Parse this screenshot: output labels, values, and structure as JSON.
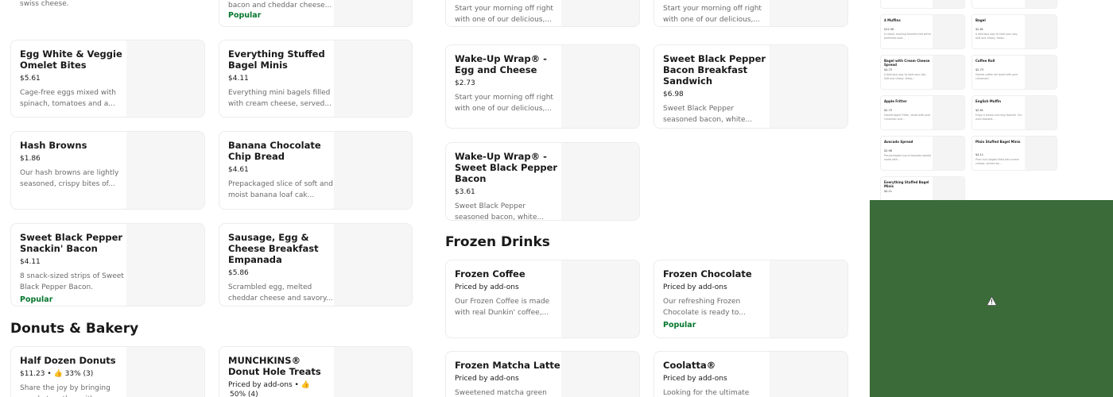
{
  "top_fragments": {
    "col1": "swiss cheese.",
    "col2_desc": "bacon and cheddar cheese...",
    "col2_badge": "Popular",
    "col3_l1": "Start your morning off right",
    "col3_l2": "with one of our delicious,...",
    "col4_l1": "Start your morning off right",
    "col4_l2": "with one of our delicious,..."
  },
  "col1": [
    {
      "title": "Egg White & Veggie Omelet Bites",
      "price": "$5.61",
      "desc": "Cage-free eggs mixed with spinach, tomatoes and a...",
      "popular": ""
    },
    {
      "title": "Hash Browns",
      "price": "$1.86",
      "desc": "Our hash browns are lightly seasoned, crispy bites of...",
      "popular": ""
    },
    {
      "title": "Sweet Black Pepper Snackin' Bacon",
      "price": "$4.11",
      "desc": "8 snack-sized strips of Sweet Black Pepper Bacon.",
      "popular": "Popular"
    }
  ],
  "col2": [
    {
      "title": "Everything Stuffed Bagel Minis",
      "price": "$4.11",
      "desc": "Everything mini bagels filled with cream cheese, served...",
      "popular": ""
    },
    {
      "title": "Banana Chocolate Chip Bread",
      "price": "$4.61",
      "desc": "Prepackaged slice of soft and moist banana loaf cak...",
      "popular": ""
    },
    {
      "title": "Sausage, Egg & Cheese Breakfast Empanada",
      "price": "$5.86",
      "desc": "Scrambled egg, melted cheddar cheese and savory...",
      "popular": ""
    }
  ],
  "col3": [
    {
      "title": "Wake-Up Wrap® - Egg and Cheese",
      "price": "$2.73",
      "desc": "Start your morning off right with one of our delicious,...",
      "popular": ""
    },
    {
      "title": "Wake-Up Wrap® - Sweet Black Pepper Bacon",
      "price": "$3.61",
      "desc": "Sweet Black Pepper seasoned bacon, white...",
      "popular": ""
    }
  ],
  "col4": [
    {
      "title": "Sweet Black Pepper Bacon Breakfast Sandwich",
      "price": "$6.98",
      "desc": "Sweet Black Pepper seasoned bacon, white...",
      "popular": ""
    }
  ],
  "sections": {
    "donuts": "Donuts & Bakery",
    "frozen": "Frozen Drinks"
  },
  "donuts": [
    {
      "title": "Half Dozen Donuts",
      "price": "$11.23 •",
      "rating": "33% (3)",
      "desc": "Share the joy by bringing people together with an..."
    },
    {
      "title": "MUNCHKINS® Donut Hole Treats",
      "price": "Priced by add-ons •",
      "rating": "50% (4)",
      "desc": ""
    }
  ],
  "frozen": [
    {
      "title": "Frozen Coffee",
      "price": "Priced by add-ons",
      "desc": "Our Frozen Coffee is made with real Dunkin' coffee,...",
      "popular": ""
    },
    {
      "title": "Frozen Chocolate",
      "price": "Priced by add-ons",
      "desc": "Our refreshing Frozen Chocolate is ready to...",
      "popular": "Popular"
    },
    {
      "title": "Frozen Matcha Latte",
      "price": "Priced by add-ons",
      "desc": "Sweetened matcha green",
      "popular": ""
    },
    {
      "title": "Coolatta®",
      "price": "Priced by add-ons",
      "desc": "Looking for the ultimate",
      "popular": ""
    }
  ],
  "thumbnail": {
    "items": [
      {
        "title": "4 Muffins",
        "price": "$12.36",
        "desc": "A classic morning favorite that we've perfected over..."
      },
      {
        "title": "Bagel",
        "price": "$2.61",
        "desc": "A delicious way to start your day. Soft and chewy, these..."
      },
      {
        "title": "Bagel with Cream Cheese Spread",
        "price": "$4.73",
        "desc": "A delicious way to start your day. Soft and chewy, these..."
      },
      {
        "title": "Coffee Roll",
        "price": "$2.73",
        "desc": "Glazed coffee roll laced with pure cinnamon!"
      },
      {
        "title": "Apple Fritter",
        "price": "$2.73",
        "desc": "Glazed Apple Fritter, laced with pure cinnamon and..."
      },
      {
        "title": "English Muffin",
        "price": "$2.61",
        "desc": "Enjoy a classic morning favorite. Our oven-toasted..."
      },
      {
        "title": "Avocado Spread",
        "price": "$2.98",
        "desc": "Pre-packaged cup of avocado spread made with..."
      },
      {
        "title": "Plain Stuffed Bagel Minis",
        "price": "$4.11",
        "desc": "Plain mini bagels filled with cream cheese, served wa..."
      },
      {
        "title": "Everything Stuffed Bagel Minis",
        "price": "$4.11",
        "desc": ""
      }
    ]
  },
  "colors": {
    "popular": "#06772e",
    "overlay": "#3a6b38"
  },
  "icons": {
    "warning": "warning-icon",
    "thumbs_up": "thumbs-up-icon"
  }
}
